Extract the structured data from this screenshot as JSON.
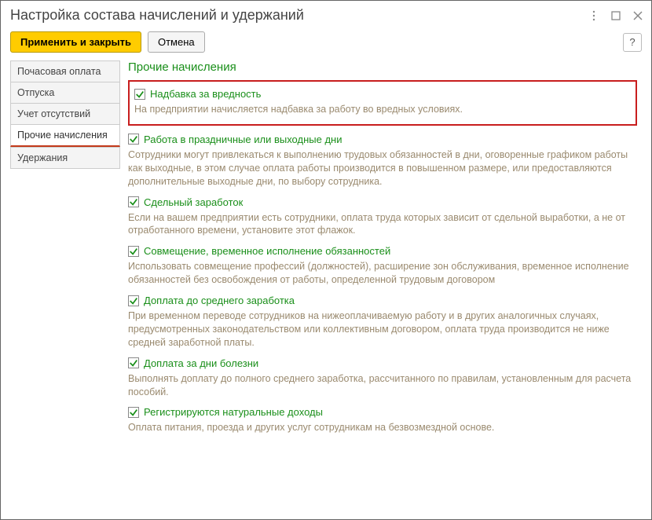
{
  "window_title": "Настройка состава начислений и удержаний",
  "toolbar": {
    "apply_close_label": "Применить и закрыть",
    "cancel_label": "Отмена",
    "help_label": "?"
  },
  "sidebar": {
    "items": [
      {
        "label": "Почасовая оплата",
        "active": false
      },
      {
        "label": "Отпуска",
        "active": false
      },
      {
        "label": "Учет отсутствий",
        "active": false
      },
      {
        "label": "Прочие начисления",
        "active": true
      },
      {
        "label": "Удержания",
        "active": false
      }
    ]
  },
  "section_title": "Прочие начисления",
  "options": [
    {
      "label": "Надбавка за вредность",
      "checked": true,
      "highlight": true,
      "desc": "На предприятии начисляется надбавка за работу во вредных условиях."
    },
    {
      "label": "Работа в праздничные или выходные дни",
      "checked": true,
      "desc": "Сотрудники могут привлекаться к выполнению трудовых обязанностей в дни, оговоренные графиком работы как выходные, в этом случае оплата работы производится в повышенном размере, или предоставляются дополнительные выходные дни, по выбору сотрудника."
    },
    {
      "label": "Сдельный заработок",
      "checked": true,
      "desc": "Если на вашем предприятии есть сотрудники, оплата труда которых зависит от сдельной выработки, а не от отработанного времени, установите этот флажок."
    },
    {
      "label": "Совмещение, временное исполнение обязанностей",
      "checked": true,
      "desc": "Использовать совмещение профессий (должностей), расширение зон обслуживания, временное исполнение обязанностей без освобождения от работы, определенной трудовым договором"
    },
    {
      "label": "Доплата до среднего заработка",
      "checked": true,
      "desc": "При временном переводе сотрудников на нижеоплачиваемую работу и в других аналогичных случаях, предусмотренных законодательством или коллективным договором, оплата труда производится не ниже средней заработной платы."
    },
    {
      "label": "Доплата за дни болезни",
      "checked": true,
      "desc": "Выполнять доплату до полного среднего заработка, рассчитанного по правилам, установленным для расчета пособий."
    },
    {
      "label": "Регистрируются натуральные доходы",
      "checked": true,
      "desc": "Оплата питания, проезда и других услуг сотрудникам на безвозмездной основе."
    }
  ]
}
